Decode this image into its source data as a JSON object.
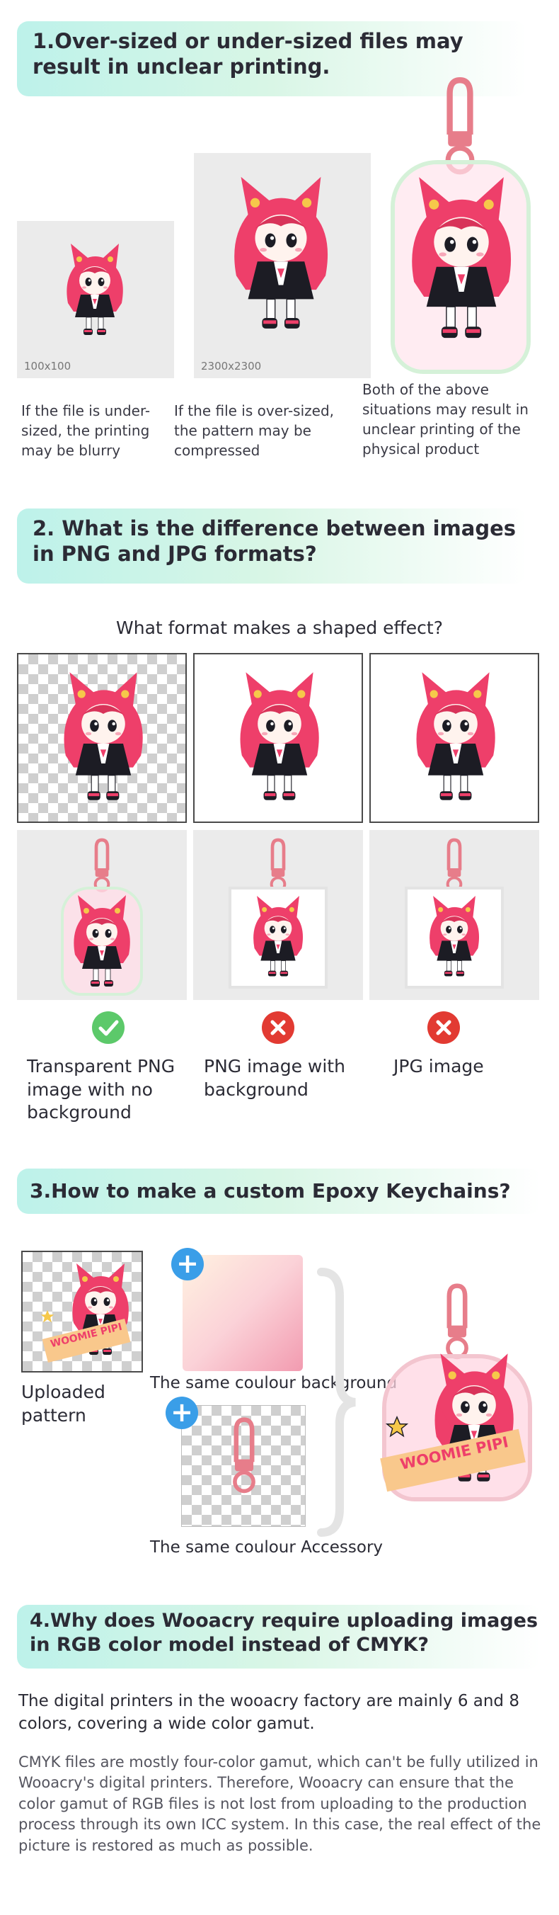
{
  "section1": {
    "heading": "1.Over-sized or under-sized files may result in unclear printing.",
    "img_small_label": "100x100",
    "img_large_label": "2300x2300",
    "caption_small": "If the file is under-sized, the printing may be blurry",
    "caption_large": "If the file is over-sized, the pattern may be compressed",
    "caption_both": "Both of the above situations may result in unclear printing of the physical product"
  },
  "section2": {
    "heading": "2. What is the difference between images in PNG and JPG formats?",
    "question": "What format makes a shaped effect?",
    "options": [
      {
        "label": "Transparent PNG image with no background",
        "status": "correct"
      },
      {
        "label": "PNG image with background",
        "status": "wrong"
      },
      {
        "label": "JPG image",
        "status": "wrong"
      }
    ]
  },
  "section3": {
    "heading": "3.How to make a custom Epoxy Keychains?",
    "uploaded_label": "Uploaded pattern",
    "background_label": "The same coulour background",
    "accessory_label": "The same coulour Accessory",
    "art_text": "WOOMIE PIPI"
  },
  "section4": {
    "heading": "4.Why does Wooacry require uploading images in RGB color model instead of CMYK?",
    "para1": "The digital printers in the wooacry factory are mainly 6 and 8 colors, covering a wide color gamut.",
    "para2": "CMYK files are mostly four-color gamut, which can't be fully utilized in Wooacry's digital printers. Therefore, Wooacry can ensure that the color gamut of RGB files is not lost from uploading to the production process through its own ICC system. In this case, the real effect of the picture is restored as much as possible."
  },
  "colors": {
    "accent_teal": "#bdf2ea",
    "character_pink": "#ee3f6a",
    "character_dark": "#1c1c24",
    "keyring_pink": "#e77d8a",
    "correct_green": "#5cc96a",
    "wrong_red": "#e23a32",
    "plus_blue": "#3a9ee8"
  },
  "icons": [
    "character-illustration",
    "keychain-clasp-icon",
    "check-icon",
    "cross-icon",
    "plus-icon",
    "star-icon",
    "curly-brace-icon"
  ]
}
